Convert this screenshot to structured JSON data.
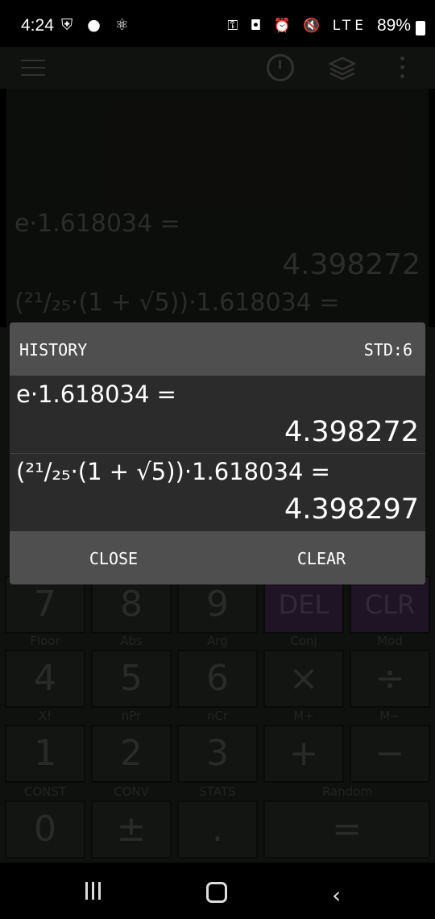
{
  "status_bar": {
    "time": "4:24",
    "left_icons": "⛨ ● ⚛",
    "right_icons": "⚿ ◘ ⏰ 🔇 LTE",
    "battery": "89%"
  },
  "toolbar": {
    "menu_icon": "hamburger-icon",
    "history_icon": "clock-icon",
    "layers_icon": "layers-icon",
    "more_icon": "more-vert-icon"
  },
  "display": {
    "expr1": "e·1.618034 =",
    "res1": "4.398272",
    "expr2": "(²¹/₂₅·(1 + √5))·1.618034 ="
  },
  "keypad": {
    "row1": [
      "7",
      "8",
      "9",
      "DEL",
      "CLR"
    ],
    "row2_labels": [
      "Floor",
      "Abs",
      "Arg",
      "Conj",
      "Mod"
    ],
    "row2": [
      "4",
      "5",
      "6",
      "×",
      "÷"
    ],
    "row3_labels": [
      "X!",
      "nPr",
      "nCr",
      "M+",
      "M−"
    ],
    "row3": [
      "1",
      "2",
      "3",
      "+",
      "−"
    ],
    "row4_labels": [
      "CONST",
      "CONV",
      "STATS",
      "Random"
    ],
    "row4": [
      "0",
      "±",
      ".",
      "="
    ]
  },
  "history_dialog": {
    "title": "HISTORY",
    "mode": "STD:6",
    "items": [
      {
        "expression": "e·1.618034 =",
        "result": "4.398272"
      },
      {
        "expression": "(²¹/₂₅·(1 + √5))·1.618034 =",
        "result": "4.398297"
      }
    ],
    "close_label": "CLOSE",
    "clear_label": "CLEAR"
  },
  "navbar": {
    "recent_icon": "recent-apps-icon",
    "home_icon": "home-icon",
    "back_icon": "back-icon"
  }
}
